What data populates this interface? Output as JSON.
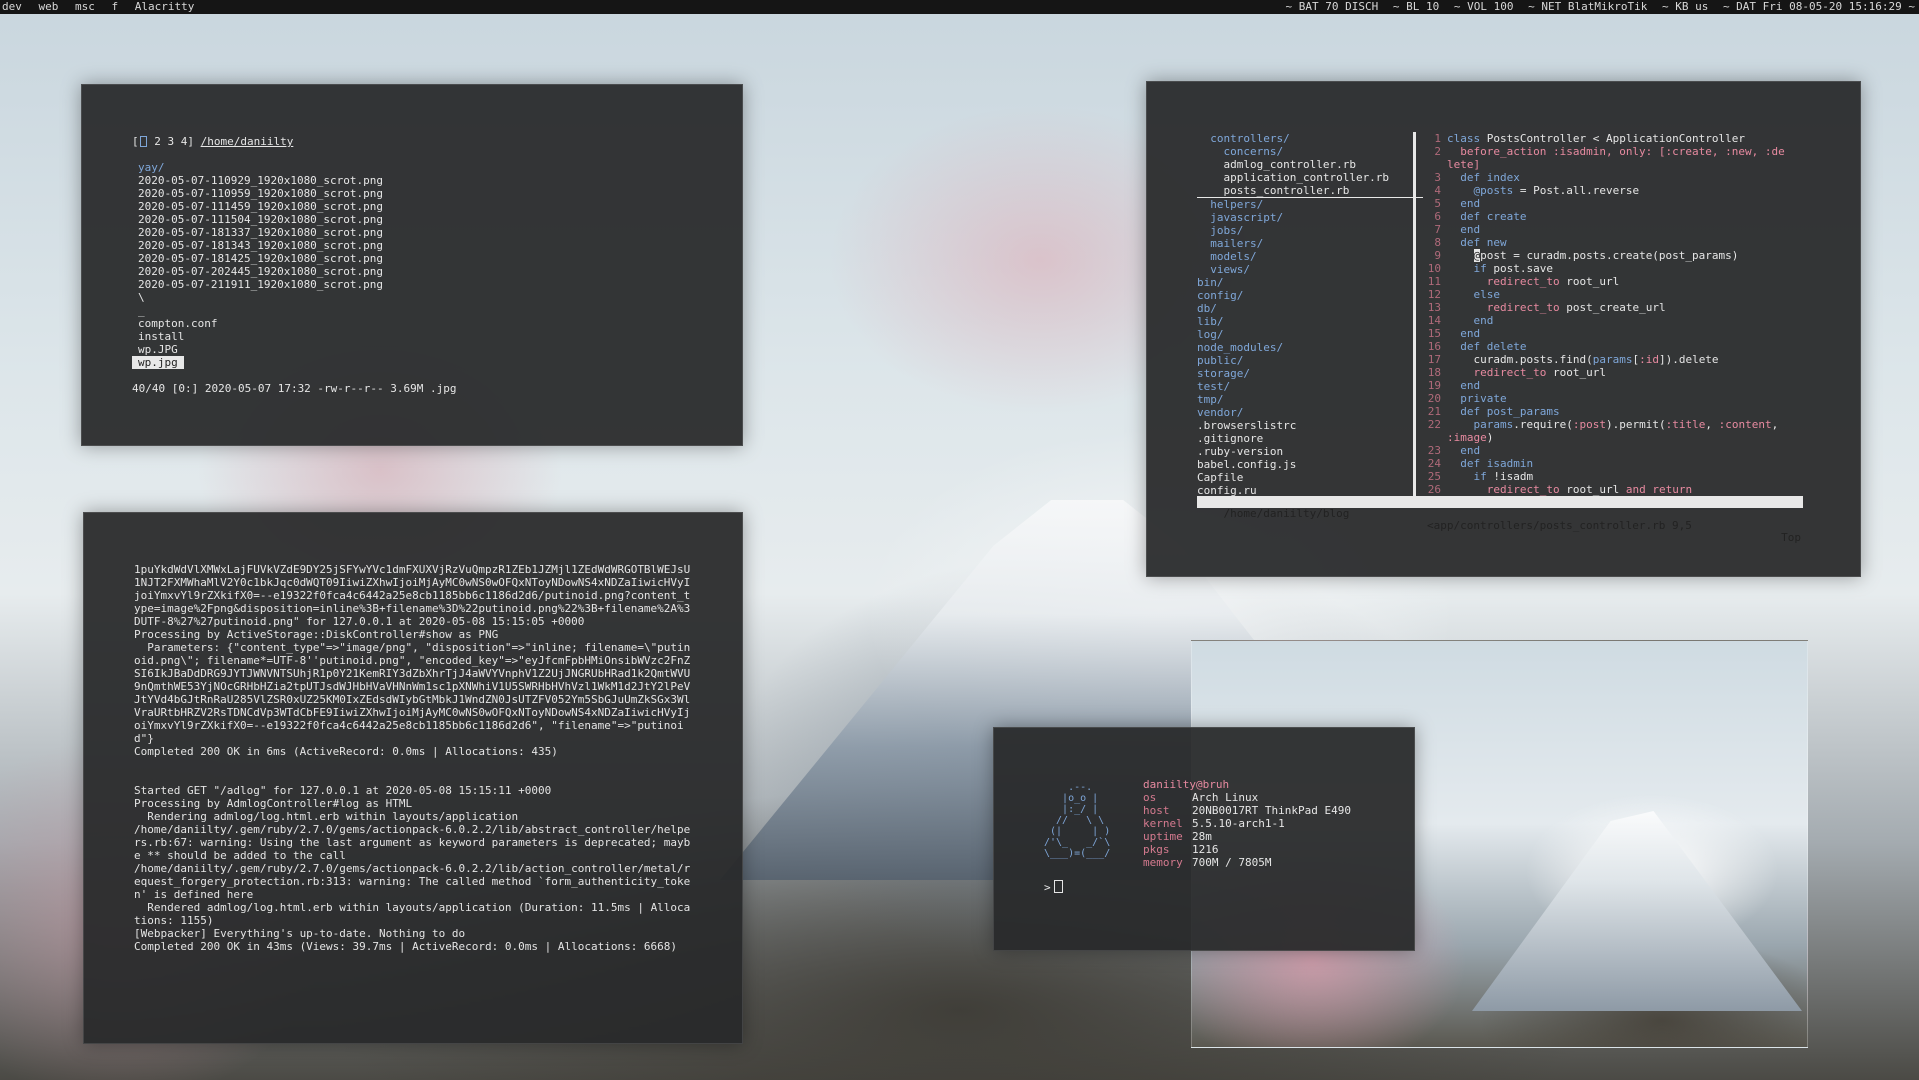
{
  "topbar": {
    "workspaces": [
      "dev",
      "web",
      "msc",
      "f"
    ],
    "window_title": "Alacritty",
    "status": [
      "~ BAT 70 DISCH",
      "~ BL 10",
      "~ VOL 100",
      "~ NET BlatMikroTik",
      "~ KB us",
      "~ DAT Fri 08-05-20 15:16:29 ~"
    ]
  },
  "ranger": {
    "tabs_prefix": "[",
    "tabs_rest": " 2 3 4]",
    "path": "/home/daniilty",
    "dir": "yay/",
    "files": [
      "2020-05-07-110929_1920x1080_scrot.png",
      "2020-05-07-110959_1920x1080_scrot.png",
      "2020-05-07-111459_1920x1080_scrot.png",
      "2020-05-07-111504_1920x1080_scrot.png",
      "2020-05-07-181337_1920x1080_scrot.png",
      "2020-05-07-181343_1920x1080_scrot.png",
      "2020-05-07-181425_1920x1080_scrot.png",
      "2020-05-07-202445_1920x1080_scrot.png",
      "2020-05-07-211911_1920x1080_scrot.png",
      "\\",
      "_",
      "compton.conf",
      "install",
      "wp.JPG"
    ],
    "selected": "wp.jpg",
    "status": "40/40 [0:] 2020-05-07 17:32 -rw-r--r-- 3.69M .jpg"
  },
  "log": {
    "text": "1puYkdWdVlXMWxLajFUVkVZdE9DY25jSFYwYVc1dmFXUXVjRzVuQmpzR1ZEb1JZMjl1ZEdWdWRGOTBlWEJsU1NJT2FXMWhaMlV2Y0c1bkJqc0dWQT09IiwiZXhwIjoiMjAyMC0wNS0wOFQxNToyNDowNS4xNDZaIiwicHVyIjoiYmxvYl9rZXkifX0=--e19322f0fca4c6442a25e8cb1185bb6c1186d2d6/putinoid.png?content_type=image%2Fpng&disposition=inline%3B+filename%3D%22putinoid.png%22%3B+filename%2A%3DUTF-8%27%27putinoid.png\" for 127.0.0.1 at 2020-05-08 15:15:05 +0000\nProcessing by ActiveStorage::DiskController#show as PNG\n  Parameters: {\"content_type\"=>\"image/png\", \"disposition\"=>\"inline; filename=\\\"putinoid.png\\\"; filename*=UTF-8''putinoid.png\", \"encoded_key\"=>\"eyJfcmFpbHMiOnsibWVzc2FnZSI6IkJBaDdDRG9JYTJWNVNTSUhjR1p0Y21KemRIY3dZbXhrTjJ4aWVYVnphV1Z2UjJNGRUbHRad1k2QmtWVU9nQmthWE53YjNOcGRHbHZia2tpUTJsdWJHbHVaVHNnWm1sc1pXNWhiV1U5SWRHbHVhVzl1WkM1d2JtY2lPeVJtYVd4bGJtRnRaU285VlZSR0xUZ25KM0IxZEdsdWIybGtMbkJ1WndZN0JsUTZFV052Ym5SbGJuUmZkSGx3WlVraURtbHRZV2RsTDNCdVp3WTdCbFE9IiwiZXhwIjoiMjAyMC0wNS0wOFQxNToyNDowNS4xNDZaIiwicHVyIjoiYmxvYl9rZXkifX0=--e19322f0fca4c6442a25e8cb1185bb6c1186d2d6\", \"filename\"=>\"putinoid\"}\nCompleted 200 OK in 6ms (ActiveRecord: 0.0ms | Allocations: 435)\n\n\nStarted GET \"/adlog\" for 127.0.0.1 at 2020-05-08 15:15:11 +0000\nProcessing by AdmlogController#log as HTML\n  Rendering admlog/log.html.erb within layouts/application\n/home/daniilty/.gem/ruby/2.7.0/gems/actionpack-6.0.2.2/lib/abstract_controller/helpers.rb:67: warning: Using the last argument as keyword parameters is deprecated; maybe ** should be added to the call\n/home/daniilty/.gem/ruby/2.7.0/gems/actionpack-6.0.2.2/lib/action_controller/metal/request_forgery_protection.rb:313: warning: The called method `form_authenticity_token' is defined here\n  Rendered admlog/log.html.erb within layouts/application (Duration: 11.5ms | Allocations: 1155)\n[Webpacker] Everything's up-to-date. Nothing to do\nCompleted 200 OK in 43ms (Views: 39.7ms | ActiveRecord: 0.0ms | Allocations: 6668)"
  },
  "vim": {
    "tree": [
      {
        "t": "  controllers/",
        "c": "blue"
      },
      {
        "t": "    concerns/",
        "c": "blue"
      },
      {
        "t": "    admlog_controller.rb",
        "c": ""
      },
      {
        "t": "    application_controller.rb",
        "c": ""
      },
      {
        "t": "    posts_controller.rb",
        "c": "ul"
      },
      {
        "t": "  helpers/",
        "c": "blue"
      },
      {
        "t": "  javascript/",
        "c": "blue"
      },
      {
        "t": "  jobs/",
        "c": "blue"
      },
      {
        "t": "  mailers/",
        "c": "blue"
      },
      {
        "t": "  models/",
        "c": "blue"
      },
      {
        "t": "  views/",
        "c": "blue"
      },
      {
        "t": "bin/",
        "c": "blue"
      },
      {
        "t": "config/",
        "c": "blue"
      },
      {
        "t": "db/",
        "c": "blue"
      },
      {
        "t": "lib/",
        "c": "blue"
      },
      {
        "t": "log/",
        "c": "blue"
      },
      {
        "t": "node_modules/",
        "c": "blue"
      },
      {
        "t": "public/",
        "c": "blue"
      },
      {
        "t": "storage/",
        "c": "blue"
      },
      {
        "t": "test/",
        "c": "blue"
      },
      {
        "t": "tmp/",
        "c": "blue"
      },
      {
        "t": "vendor/",
        "c": "blue"
      },
      {
        "t": ".browserslistrc",
        "c": ""
      },
      {
        "t": ".gitignore",
        "c": ""
      },
      {
        "t": ".ruby-version",
        "c": ""
      },
      {
        "t": "babel.config.js",
        "c": ""
      },
      {
        "t": "Capfile",
        "c": ""
      },
      {
        "t": "config.ru",
        "c": ""
      }
    ],
    "code": [
      {
        "n": "1",
        "h": "<span class='kw'>class</span> PostsController &lt; ApplicationController"
      },
      {
        "n": "2",
        "h": "  <span class='sym'>before_action :isadmin, only: [:create, :new, :de</span>"
      },
      {
        "n": "",
        "h": "<span class='sym'>lete]</span>"
      },
      {
        "n": "3",
        "h": "  <span class='kw'>def</span> <span class='kw'>index</span>"
      },
      {
        "n": "4",
        "h": "    <span class='kw'>@posts</span> = Post.all.reverse"
      },
      {
        "n": "5",
        "h": "  <span class='kw'>end</span>"
      },
      {
        "n": "6",
        "h": "  <span class='kw'>def</span> <span class='kw'>create</span>"
      },
      {
        "n": "7",
        "h": "  <span class='kw'>end</span>"
      },
      {
        "n": "8",
        "h": "  <span class='kw'>def</span> <span class='kw'>new</span>"
      },
      {
        "n": "9",
        "h": "    <span class='cursorblk'>@</span>post = curadm.posts.create(post_params)"
      },
      {
        "n": "10",
        "h": "    <span class='kw'>if</span> post.save"
      },
      {
        "n": "11",
        "h": "      <span class='sym'>redirect_to</span> root_url"
      },
      {
        "n": "12",
        "h": "    <span class='kw'>else</span>"
      },
      {
        "n": "13",
        "h": "      <span class='sym'>redirect_to</span> post_create_url"
      },
      {
        "n": "14",
        "h": "    <span class='kw'>end</span>"
      },
      {
        "n": "15",
        "h": "  <span class='kw'>end</span>"
      },
      {
        "n": "16",
        "h": "  <span class='kw'>def</span> <span class='kw'>delete</span>"
      },
      {
        "n": "17",
        "h": "    curadm.posts.find(<span class='kw'>params</span>[<span class='sym'>:id</span>]).delete"
      },
      {
        "n": "18",
        "h": "    <span class='sym'>redirect_to</span> root_url"
      },
      {
        "n": "19",
        "h": "  <span class='kw'>end</span>"
      },
      {
        "n": "20",
        "h": "  <span class='kw'>private</span>"
      },
      {
        "n": "21",
        "h": "  <span class='kw'>def</span> <span class='kw'>post_params</span>"
      },
      {
        "n": "22",
        "h": "    <span class='kw'>params</span>.require(<span class='sym'>:post</span>).permit(<span class='sym'>:title</span>, <span class='sym'>:content</span>,"
      },
      {
        "n": "",
        "h": "<span class='sym'>:image</span>)"
      },
      {
        "n": "23",
        "h": "  <span class='kw'>end</span>"
      },
      {
        "n": "24",
        "h": "  <span class='kw'>def</span> <span class='kw'>isadmin</span>"
      },
      {
        "n": "25",
        "h": "    <span class='kw'>if</span> !isadm"
      },
      {
        "n": "26",
        "h": "      <span class='sym'>redirect_to</span> root_url <span class='sym'>and return</span>"
      }
    ],
    "status_left": "/home/daniilty/blog",
    "status_file": "<app/controllers/posts_controller.rb 9,5",
    "status_right": "Top"
  },
  "fetch": {
    "logo": "    .--.\n   |o_o |\n   |:_/ |\n  //   \\ \\\n (|     | )\n/'\\_   _/`\\\n\\___)=(___/",
    "user": "daniilty@bruh",
    "rows": [
      {
        "k": "os",
        "v": "Arch Linux"
      },
      {
        "k": "host",
        "v": "20NB0017RT ThinkPad E490"
      },
      {
        "k": "kernel",
        "v": "5.5.10-arch1-1"
      },
      {
        "k": "uptime",
        "v": "28m"
      },
      {
        "k": "pkgs",
        "v": "1216"
      },
      {
        "k": "memory",
        "v": "700M / 7805M"
      }
    ],
    "prompt": ">"
  }
}
